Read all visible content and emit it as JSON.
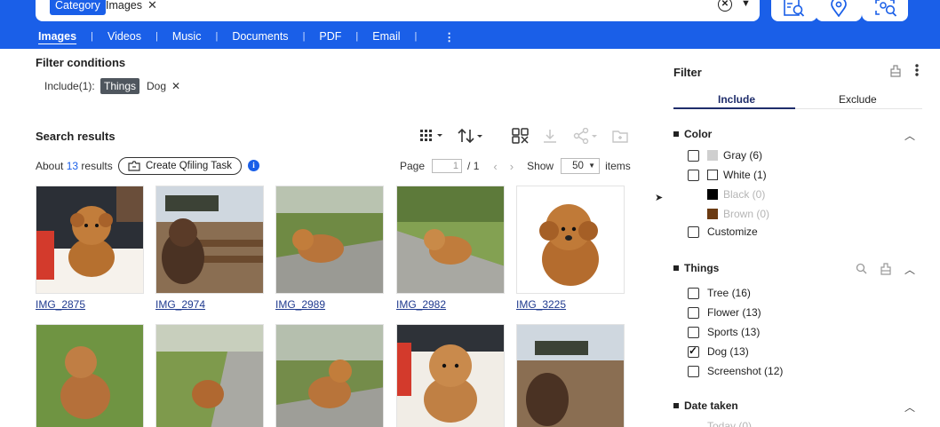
{
  "header": {
    "category_label": "Category",
    "search_token": "Images",
    "close_glyph": "✕",
    "clear_glyph": "✕",
    "dropdown_glyph": "▼",
    "file_types": [
      "Images",
      "Videos",
      "Music",
      "Documents",
      "PDF",
      "Email"
    ],
    "more_glyph": "⋮",
    "tool_icons": [
      "image-search-icon",
      "location-pin-icon",
      "face-search-icon"
    ],
    "accent_color": "#1a5fe8"
  },
  "filter_conditions": {
    "title": "Filter conditions",
    "include_label": "Include(1):",
    "chip_label": "Things",
    "value": "Dog",
    "remove_glyph": "✕"
  },
  "results": {
    "title": "Search results",
    "about_prefix": "About",
    "count": "13",
    "about_suffix": "results",
    "qfiling_label": "Create Qfiling Task",
    "info_glyph": "i",
    "page_label": "Page",
    "page_value": "1",
    "page_total": "/ 1",
    "prev_glyph": "‹",
    "next_glyph": "›",
    "show_label": "Show",
    "page_size": "50",
    "items_label": "items",
    "thumbnails": [
      {
        "name": "IMG_2875"
      },
      {
        "name": "IMG_2974"
      },
      {
        "name": "IMG_2989"
      },
      {
        "name": "IMG_2982"
      },
      {
        "name": "IMG_3225"
      },
      {
        "name": ""
      },
      {
        "name": ""
      },
      {
        "name": ""
      },
      {
        "name": ""
      },
      {
        "name": ""
      }
    ]
  },
  "filter_panel": {
    "title": "Filter",
    "tabs": [
      "Include",
      "Exclude"
    ],
    "color": {
      "title": "Color",
      "options": [
        {
          "label": "Gray (6)",
          "swatch": "#cfcfcf",
          "enabled": true
        },
        {
          "label": "White (1)",
          "swatch": "#ffffff",
          "enabled": true
        },
        {
          "label": "Black (0)",
          "swatch": "#000000",
          "enabled": false
        },
        {
          "label": "Brown (0)",
          "swatch": "#6b3a12",
          "enabled": false
        }
      ],
      "customize_label": "Customize"
    },
    "things": {
      "title": "Things",
      "options": [
        {
          "label": "Tree (16)",
          "checked": false
        },
        {
          "label": "Flower (13)",
          "checked": false
        },
        {
          "label": "Sports (13)",
          "checked": false
        },
        {
          "label": "Dog (13)",
          "checked": true
        },
        {
          "label": "Screenshot (12)",
          "checked": false
        }
      ]
    },
    "date_taken": {
      "title": "Date taken",
      "first_option": "Today (0)"
    },
    "collapse_glyph": "︿"
  }
}
